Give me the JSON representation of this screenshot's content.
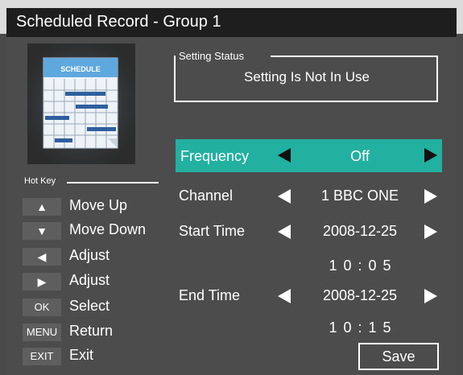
{
  "title": "Scheduled Record - Group 1",
  "thumbnail": {
    "label": "SCHEDULE"
  },
  "setting_status": {
    "label": "Setting Status",
    "value": "Setting Is Not In Use"
  },
  "hotkeys": {
    "title": "Hot Key",
    "items": [
      {
        "key": "▲",
        "label": "Move Up"
      },
      {
        "key": "▼",
        "label": "Move Down"
      },
      {
        "key": "◀",
        "label": "Adjust"
      },
      {
        "key": "▶",
        "label": "Adjust"
      },
      {
        "key": "OK",
        "label": "Select"
      },
      {
        "key": "MENU",
        "label": "Return"
      },
      {
        "key": "EXIT",
        "label": "Exit"
      }
    ]
  },
  "fields": {
    "frequency": {
      "label": "Frequency",
      "value": "Off"
    },
    "channel": {
      "label": "Channel",
      "value": "1 BBC ONE"
    },
    "start_time": {
      "label": "Start Time",
      "date": "2008-12-25",
      "time": "1 0 : 0 5"
    },
    "end_time": {
      "label": "End Time",
      "date": "2008-12-25",
      "time": "1 0 : 1 5"
    }
  },
  "save_label": "Save",
  "colors": {
    "highlight": "#22b0a0",
    "background": "#4a4a4a",
    "title_bar": "#1e1e1e"
  }
}
